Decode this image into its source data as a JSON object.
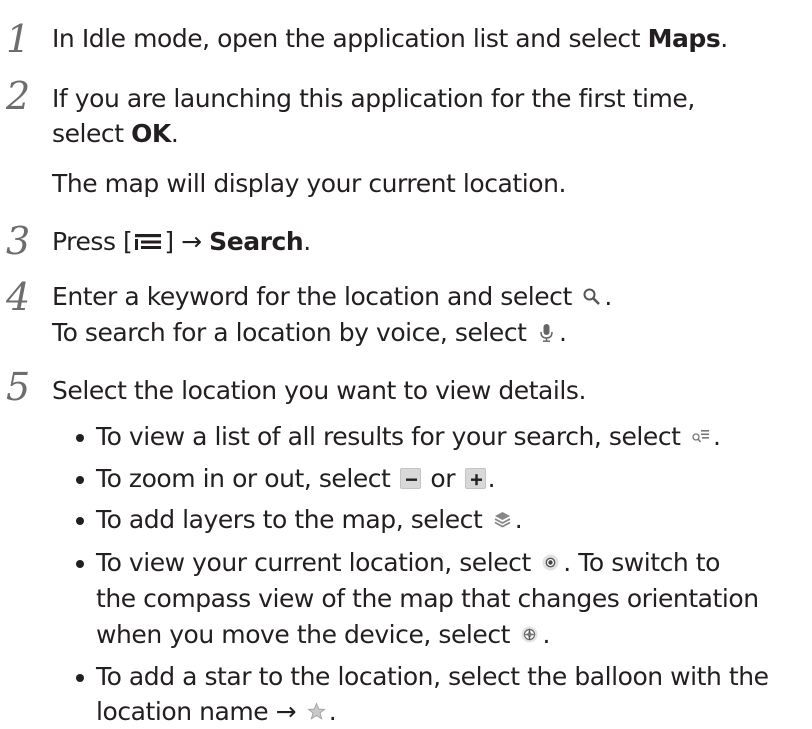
{
  "steps": [
    {
      "number": "1",
      "lines": [
        {
          "parts": [
            {
              "t": "In Idle mode, open the application list and select "
            },
            {
              "t": "Maps",
              "b": true
            },
            {
              "t": "."
            }
          ]
        }
      ]
    },
    {
      "number": "2",
      "lines": [
        {
          "parts": [
            {
              "t": "If you are launching this application for the first time,"
            }
          ]
        },
        {
          "parts": [
            {
              "t": "select "
            },
            {
              "t": "OK",
              "b": true
            },
            {
              "t": "."
            }
          ]
        },
        {
          "parts": [
            {
              "t": "The map will display your current location."
            }
          ]
        }
      ]
    },
    {
      "number": "3",
      "lines": [
        {
          "parts": [
            {
              "t": "Press ["
            },
            {
              "icon": "menu-key-icon"
            },
            {
              "t": "] → "
            },
            {
              "t": "Search",
              "b": true
            },
            {
              "t": "."
            }
          ]
        }
      ]
    },
    {
      "number": "4",
      "lines": [
        {
          "parts": [
            {
              "t": "Enter a keyword for the location and select "
            },
            {
              "icon": "search-icon"
            },
            {
              "t": "."
            }
          ]
        },
        {
          "parts": [
            {
              "t": "To search for a location by voice, select "
            },
            {
              "icon": "microphone-icon"
            },
            {
              "t": "."
            }
          ]
        }
      ]
    },
    {
      "number": "5",
      "lines": [
        {
          "parts": [
            {
              "t": "Select the location you want to view details."
            }
          ]
        }
      ]
    }
  ],
  "bullets": [
    {
      "lines": [
        {
          "parts": [
            {
              "t": "To view a list of all results for your search, select "
            },
            {
              "icon": "results-list-icon"
            },
            {
              "t": "."
            }
          ]
        }
      ]
    },
    {
      "lines": [
        {
          "parts": [
            {
              "t": "To zoom in or out, select "
            },
            {
              "icon": "zoom-out-icon"
            },
            {
              "t": " or "
            },
            {
              "icon": "zoom-in-icon"
            },
            {
              "t": "."
            }
          ]
        }
      ]
    },
    {
      "lines": [
        {
          "parts": [
            {
              "t": "To add layers to the map, select "
            },
            {
              "icon": "layers-icon"
            },
            {
              "t": "."
            }
          ]
        }
      ]
    },
    {
      "lines": [
        {
          "parts": [
            {
              "t": "To view your current location, select "
            },
            {
              "icon": "my-location-icon"
            },
            {
              "t": ". To switch to"
            }
          ]
        },
        {
          "parts": [
            {
              "t": "the compass view of the map that changes orientation"
            }
          ]
        },
        {
          "parts": [
            {
              "t": "when you move the device, select "
            },
            {
              "icon": "compass-icon"
            },
            {
              "t": "."
            }
          ]
        }
      ]
    },
    {
      "lines": [
        {
          "parts": [
            {
              "t": "To add a star to the location, select the balloon with the"
            }
          ]
        },
        {
          "parts": [
            {
              "t": "location name → "
            },
            {
              "icon": "star-icon"
            },
            {
              "t": "."
            }
          ]
        }
      ]
    }
  ]
}
